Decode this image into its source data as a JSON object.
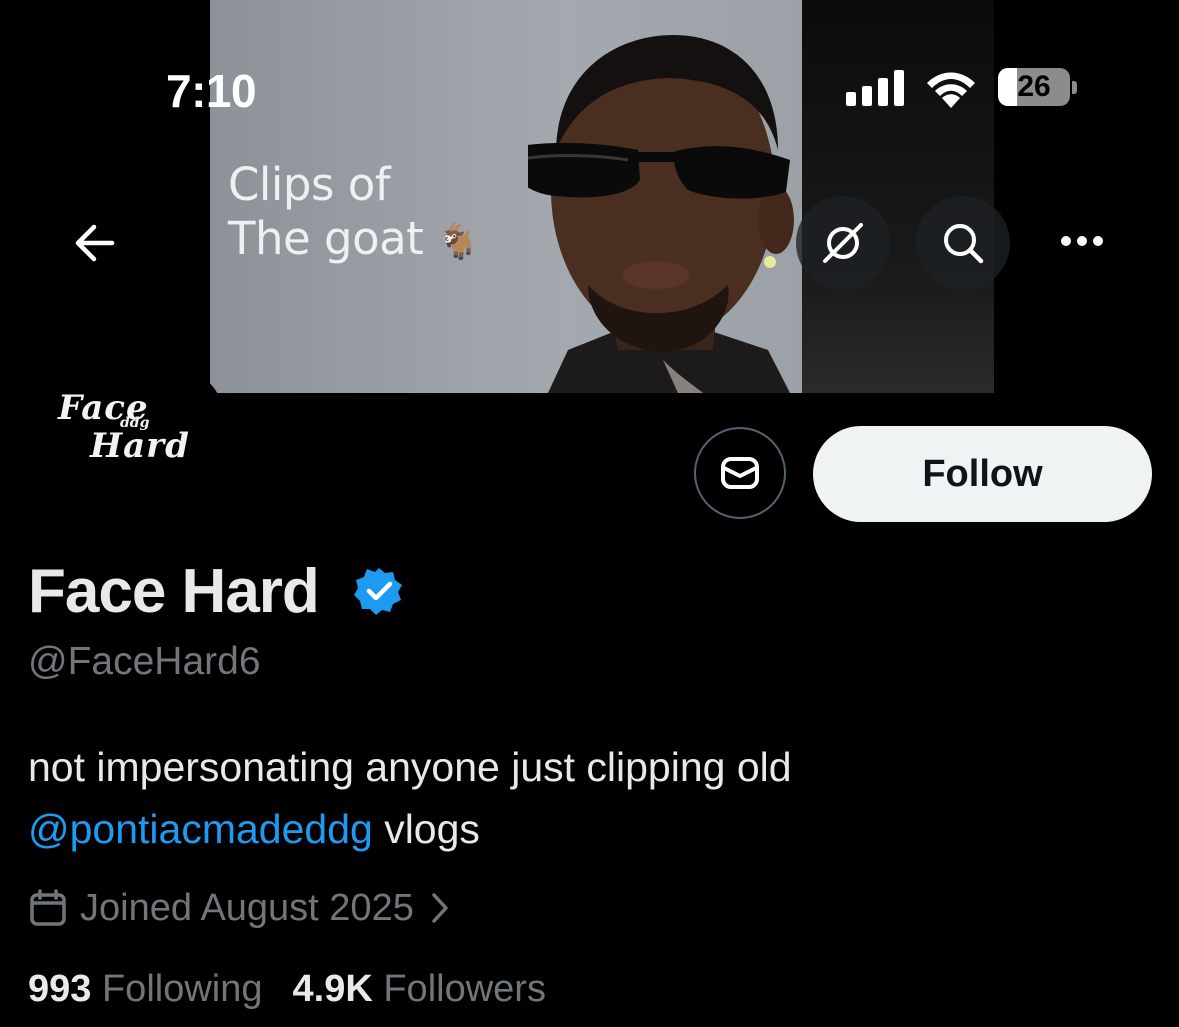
{
  "status_bar": {
    "time": "7:10",
    "battery": "26",
    "battery_level": 0.26
  },
  "banner": {
    "caption_line1": "Clips of",
    "caption_line2": "The goat",
    "caption_emoji": "🐐"
  },
  "nav": {
    "back_icon": "arrow-left-icon",
    "hide_icon": "eye-off-icon",
    "search_icon": "search-icon",
    "more_icon": "more-horizontal-icon"
  },
  "avatar": {
    "logo_word1": "Face",
    "logo_small": "ddg",
    "logo_word2": "Hard"
  },
  "actions": {
    "message_icon": "envelope-icon",
    "follow_label": "Follow"
  },
  "profile": {
    "display_name": "Face Hard",
    "handle": "@FaceHard6",
    "bio_text": "not impersonating anyone just clipping old",
    "bio_mention": "@pontiacmadeddg",
    "bio_suffix": " vlogs",
    "joined": "Joined August 2025",
    "following_count": "993",
    "following_label": "Following",
    "followers_count": "4.9K",
    "followers_label": "Followers"
  },
  "colors": {
    "background": "#000000",
    "text_primary": "#e7e9ea",
    "text_secondary": "#71767b",
    "link": "#1d9bf0",
    "verified": "#1d9bf0",
    "follow_button_bg": "#eff3f4"
  }
}
